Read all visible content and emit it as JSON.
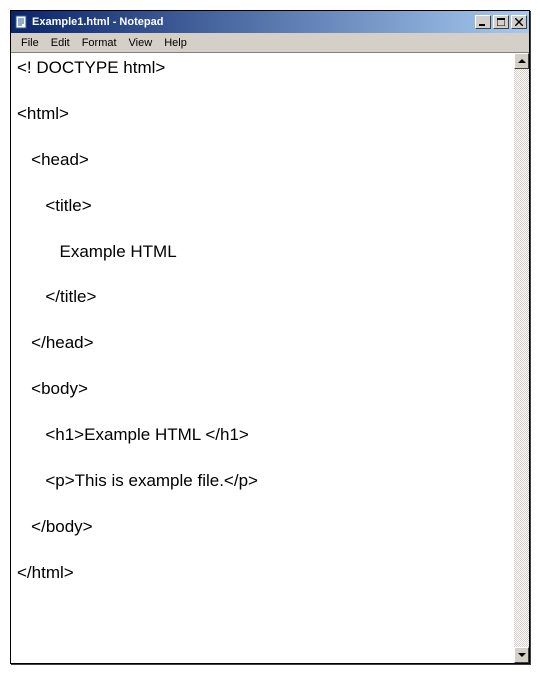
{
  "window": {
    "title": "Example1.html - Notepad"
  },
  "menu": {
    "file": "File",
    "edit": "Edit",
    "format": "Format",
    "view": "View",
    "help": "Help"
  },
  "editor": {
    "content": "<! DOCTYPE html>\n\n<html>\n\n   <head>\n\n      <title>\n\n         Example HTML\n\n      </title>\n\n   </head>\n\n   <body>\n\n      <h1>Example HTML </h1>\n\n      <p>This is example file.</p>\n\n   </body>\n\n</html>"
  }
}
